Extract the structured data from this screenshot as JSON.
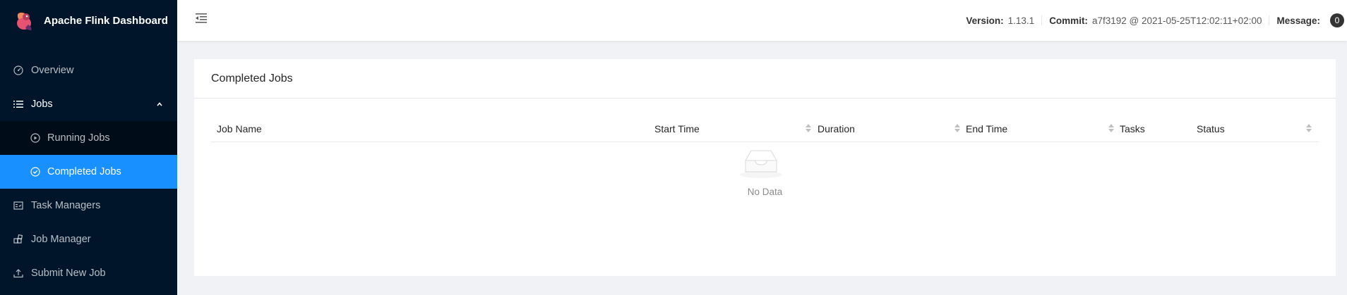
{
  "app": {
    "title": "Apache Flink Dashboard"
  },
  "sidebar": {
    "items": [
      {
        "label": "Overview",
        "icon": "dashboard-icon"
      },
      {
        "label": "Jobs",
        "icon": "list-icon",
        "open": true,
        "children": [
          {
            "label": "Running Jobs",
            "icon": "play-circle-icon"
          },
          {
            "label": "Completed Jobs",
            "icon": "check-circle-icon",
            "active": true
          }
        ]
      },
      {
        "label": "Task Managers",
        "icon": "schedule-icon"
      },
      {
        "label": "Job Manager",
        "icon": "build-icon"
      },
      {
        "label": "Submit New Job",
        "icon": "upload-icon"
      }
    ],
    "active_color": "#1890ff",
    "background": "#001529"
  },
  "header": {
    "version_label": "Version:",
    "version_value": "1.13.1",
    "commit_label": "Commit:",
    "commit_value": "a7f3192 @ 2021-05-25T12:02:11+02:00",
    "message_label": "Message:",
    "message_count": "0"
  },
  "card": {
    "title": "Completed Jobs",
    "columns": [
      "Job Name",
      "Start Time",
      "Duration",
      "End Time",
      "Tasks",
      "Status"
    ],
    "empty_text": "No Data"
  }
}
